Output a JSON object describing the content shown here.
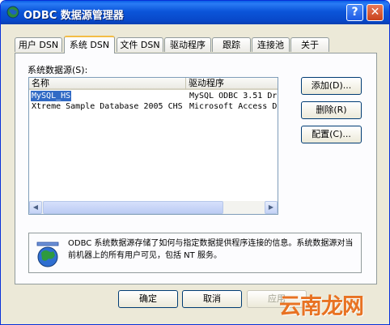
{
  "window": {
    "title": "ODBC 数据源管理器",
    "help": "?",
    "close": "✕"
  },
  "tabs": [
    "用户 DSN",
    "系统 DSN",
    "文件 DSN",
    "驱动程序",
    "跟踪",
    "连接池",
    "关于"
  ],
  "active_tab": "系统 DSN",
  "list": {
    "label": "系统数据源(S):",
    "columns": [
      "名称",
      "驱动程序"
    ],
    "rows": [
      {
        "name": "MySQL_HS",
        "driver": "MySQL ODBC 3.51 Dr"
      },
      {
        "name": "Xtreme Sample Database 2005 CHS",
        "driver": "Microsoft Access D"
      }
    ],
    "scroll_left": "◀",
    "scroll_right": "▶"
  },
  "side_buttons": {
    "add": "添加(D)...",
    "remove": "删除(R)",
    "configure": "配置(C)..."
  },
  "info": "ODBC 系统数据源存储了如何与指定数据提供程序连接的信息。系统数据源对当前机器上的所有用户可见，包括 NT 服务。",
  "bottom_buttons": {
    "ok": "确定",
    "cancel": "取消",
    "apply": "应用"
  },
  "watermark": "云南龙网",
  "colors": {
    "titlebar": "#0b55d9",
    "selection": "#316ac5",
    "watermark": "#e87222",
    "face": "#ece9d8"
  }
}
